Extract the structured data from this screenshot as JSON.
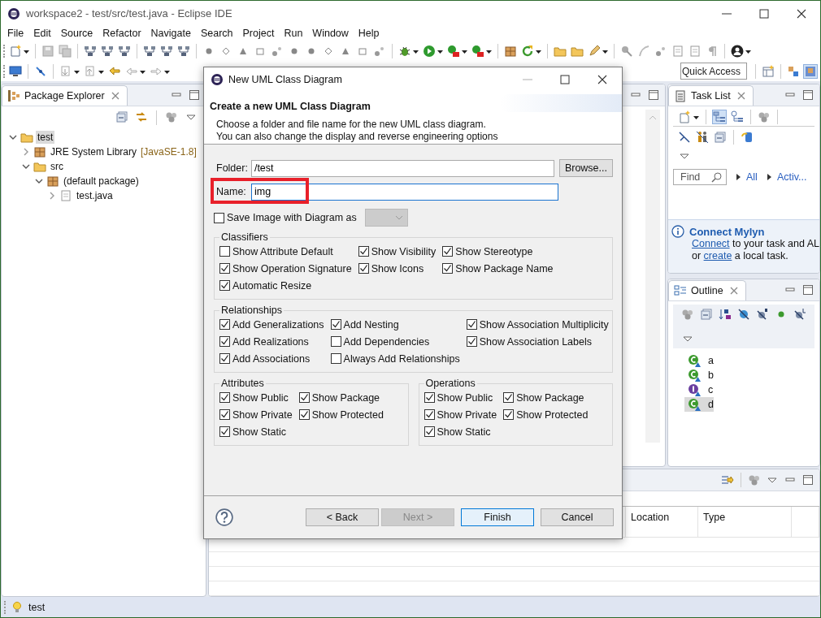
{
  "window": {
    "title": "workspace2 - test/src/test.java - Eclipse IDE"
  },
  "menu": [
    "File",
    "Edit",
    "Source",
    "Refactor",
    "Navigate",
    "Search",
    "Project",
    "Run",
    "Window",
    "Help"
  ],
  "quick_access": {
    "placeholder": "Quick Access"
  },
  "package_explorer": {
    "title": "Package Explorer",
    "tree": [
      {
        "label": "test",
        "kind": "project",
        "selected": true,
        "expanded": true,
        "children": [
          {
            "label": "JRE System Library",
            "suffix": "[JavaSE-1.8]",
            "kind": "library",
            "selected": false,
            "expanded": false
          },
          {
            "label": "src",
            "kind": "folder",
            "selected": false,
            "expanded": true,
            "children": [
              {
                "label": "(default package)",
                "kind": "package",
                "selected": false,
                "expanded": true,
                "children": [
                  {
                    "label": "test.java",
                    "kind": "file",
                    "selected": false,
                    "expanded": false
                  }
                ]
              }
            ]
          }
        ]
      }
    ]
  },
  "task_list": {
    "title": "Task List",
    "find": {
      "placeholder": "Find"
    },
    "filters": [
      "All",
      "Activ..."
    ],
    "connect": {
      "heading": "Connect Mylyn",
      "lines": [
        [
          {
            "text": "Connect",
            "link": true
          },
          {
            "text": " to your task and AL",
            "link": false
          }
        ],
        [
          {
            "text": "or ",
            "link": false
          },
          {
            "text": "create",
            "link": true
          },
          {
            "text": " a local task.",
            "link": false
          }
        ]
      ]
    }
  },
  "outline": {
    "title": "Outline",
    "items": [
      {
        "label": "a",
        "kind": "class",
        "selected": false
      },
      {
        "label": "b",
        "kind": "class",
        "selected": false
      },
      {
        "label": "c",
        "kind": "interface",
        "selected": false
      },
      {
        "label": "d",
        "kind": "class",
        "selected": true
      }
    ]
  },
  "problems": {
    "columns": [
      "Location",
      "Type"
    ]
  },
  "status_bar": {
    "text": "test"
  },
  "dialog": {
    "title": "New UML Class Diagram",
    "heading": "Create a new UML Class Diagram",
    "description": [
      "Choose a folder and file name for the new UML class diagram.",
      "You can also change the display and reverse engineering options"
    ],
    "folder": {
      "label": "Folder:",
      "value": "/test"
    },
    "browse": "Browse...",
    "name": {
      "label": "Name:",
      "value": "img",
      "highlighted": true
    },
    "save_image": {
      "label": "Save Image with Diagram as",
      "checked": false
    },
    "group_rows": [
      [
        {
          "title": "Classifiers",
          "kind": "three-column",
          "options": [
            {
              "label": "Show Attribute Default",
              "checked": false
            },
            {
              "label": "Show Visibility",
              "checked": true
            },
            {
              "label": "Show Stereotype",
              "checked": true
            },
            {
              "label": "Show Operation Signature",
              "checked": true
            },
            {
              "label": "Show Icons",
              "checked": true
            },
            {
              "label": "Show Package Name",
              "checked": true
            },
            {
              "label": "Automatic Resize",
              "checked": true
            }
          ]
        }
      ],
      [
        {
          "title": "Relationships",
          "kind": "three-column",
          "options": [
            {
              "label": "Add Generalizations",
              "checked": true
            },
            {
              "label": "Add Nesting",
              "checked": true
            },
            {
              "label": "Show Association Multiplicity",
              "checked": true
            },
            {
              "label": "Add Realizations",
              "checked": true
            },
            {
              "label": "Add Dependencies",
              "checked": false
            },
            {
              "label": "Show Association Labels",
              "checked": true
            },
            {
              "label": "Add Associations",
              "checked": true
            },
            {
              "label": "Always Add Relationships",
              "checked": false
            }
          ]
        }
      ],
      [
        {
          "title": "Attributes",
          "kind": "two-column",
          "options": [
            {
              "label": "Show Public",
              "checked": true
            },
            {
              "label": "Show Package",
              "checked": true
            },
            {
              "label": "Show Private",
              "checked": true
            },
            {
              "label": "Show Protected",
              "checked": true
            },
            {
              "label": "Show Static",
              "checked": true
            }
          ]
        },
        {
          "title": "Operations",
          "kind": "two-column",
          "options": [
            {
              "label": "Show Public",
              "checked": true
            },
            {
              "label": "Show Package",
              "checked": true
            },
            {
              "label": "Show Private",
              "checked": true
            },
            {
              "label": "Show Protected",
              "checked": true
            },
            {
              "label": "Show Static",
              "checked": true
            }
          ]
        }
      ]
    ],
    "buttons": [
      {
        "label": "< Back",
        "disabled": false,
        "default": false
      },
      {
        "label": "Next >",
        "disabled": true,
        "default": false
      },
      {
        "label": "Finish",
        "disabled": false,
        "default": true
      },
      {
        "label": "Cancel",
        "disabled": false,
        "default": false
      }
    ]
  }
}
